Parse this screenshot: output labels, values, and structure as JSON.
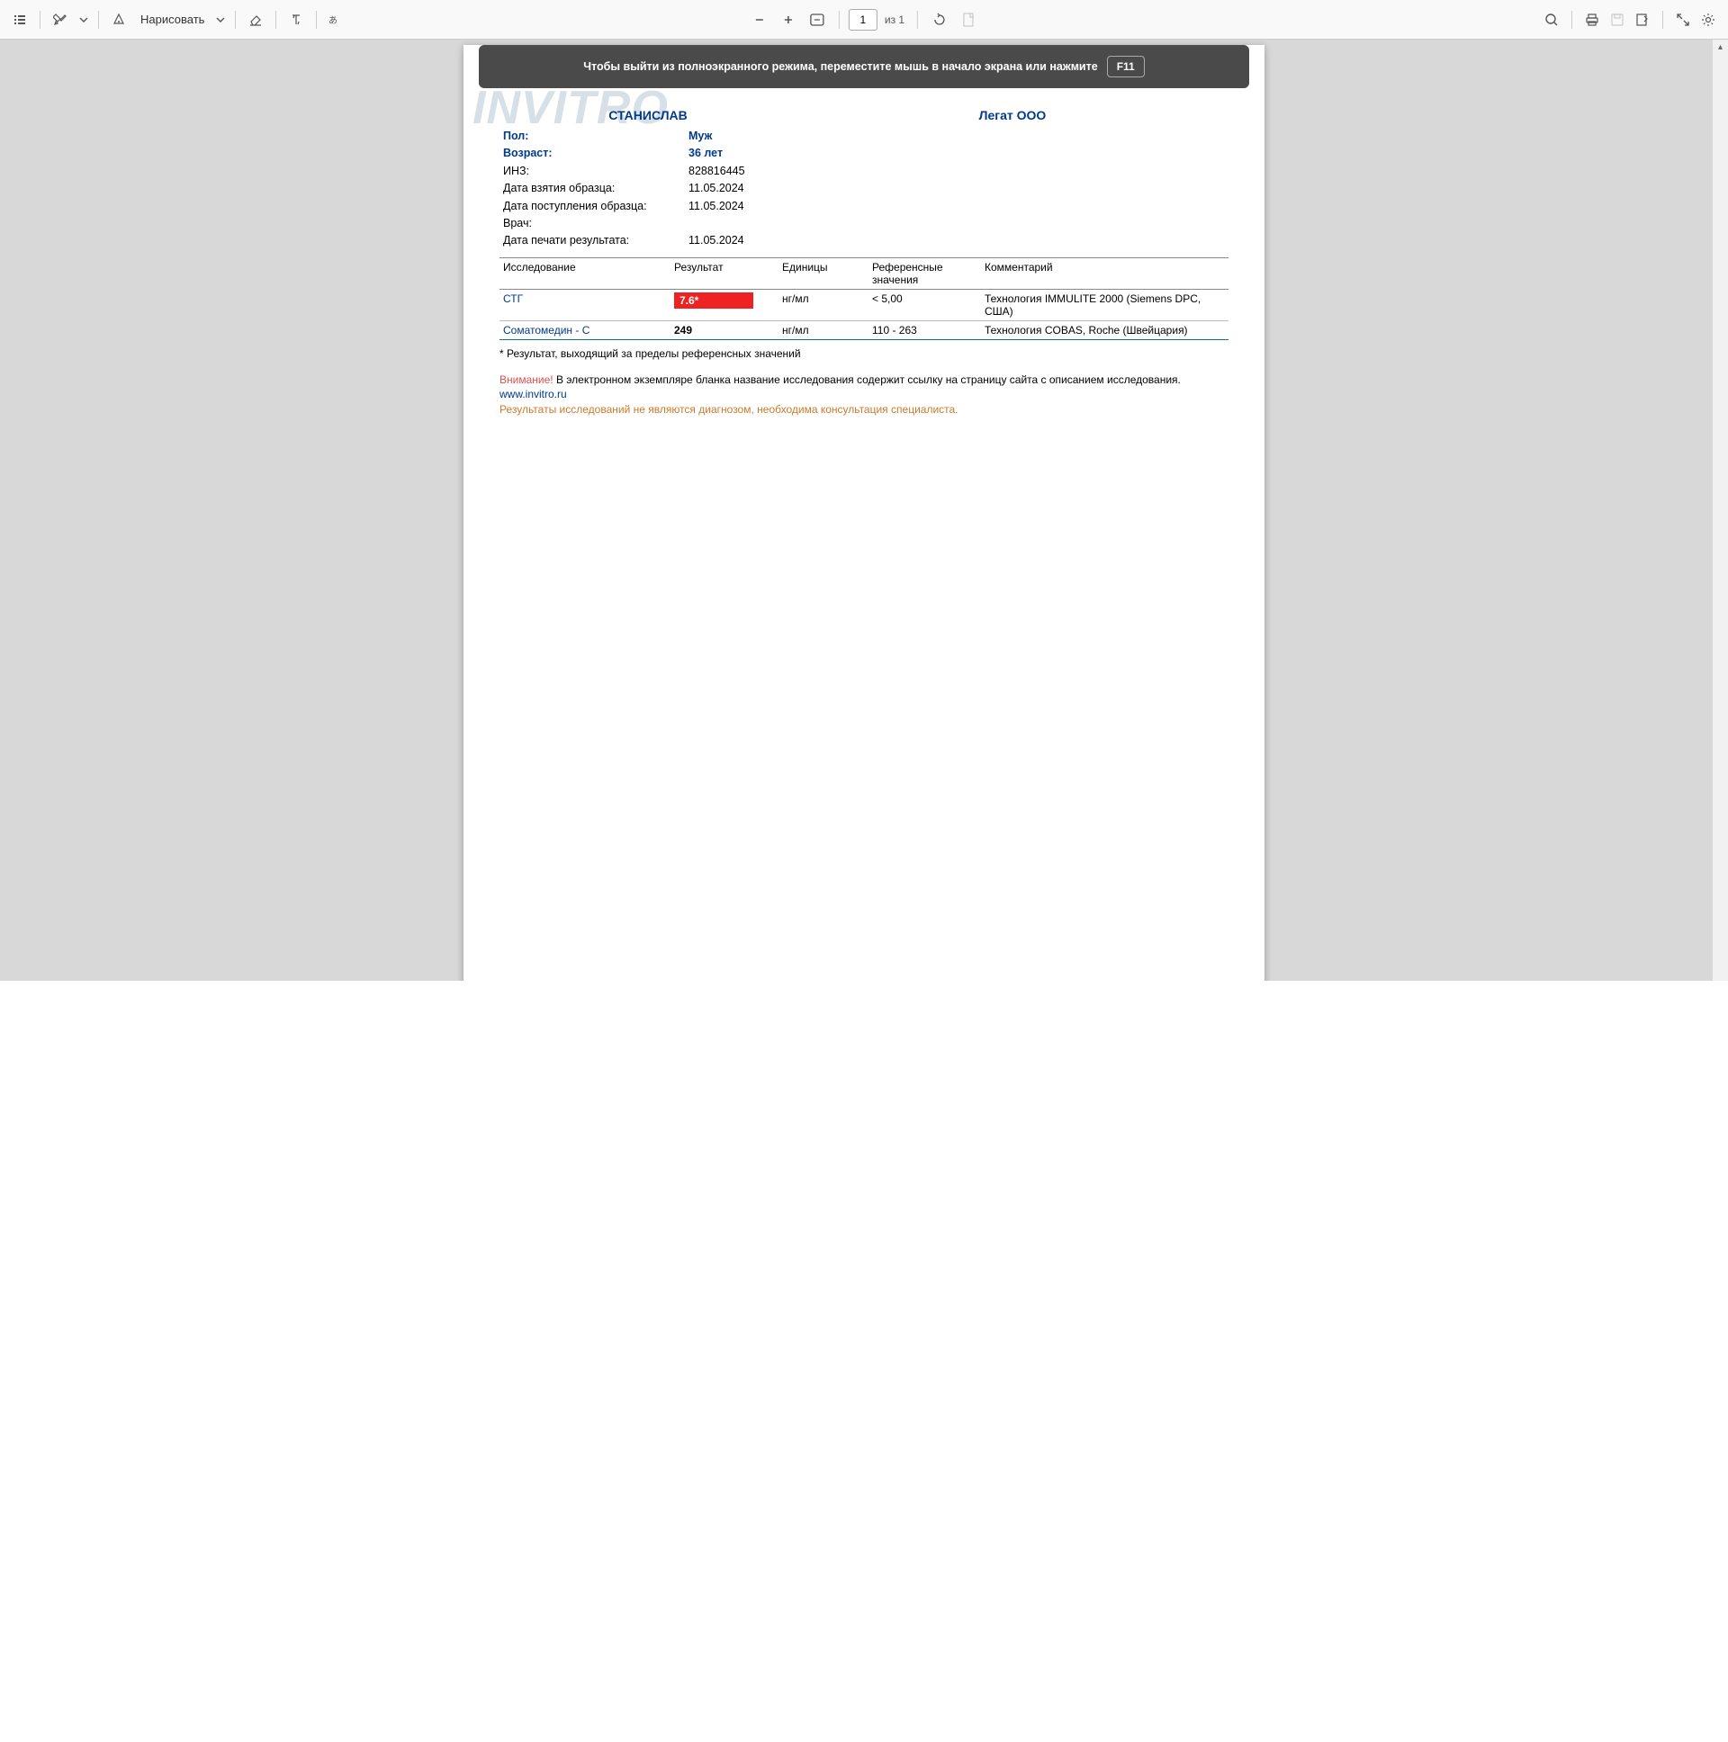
{
  "toolbar": {
    "draw_label": "Нарисовать",
    "page_value": "1",
    "page_of": "из 1"
  },
  "notice": {
    "text": "Чтобы выйти из полноэкранного режима, переместите мышь в начало экрана или нажмите",
    "key": "F11"
  },
  "watermark": "INVITRO",
  "header": {
    "patient": "СТАНИСЛАВ",
    "org": "Легат ООО"
  },
  "info": [
    {
      "label": "Пол:",
      "value": "Муж",
      "bold": true
    },
    {
      "label": "Возраст:",
      "value": "36 лет",
      "bold": true
    },
    {
      "label": "ИНЗ:",
      "value": "828816445"
    },
    {
      "label": "Дата взятия образца:",
      "value": "11.05.2024"
    },
    {
      "label": "Дата поступления образца:",
      "value": "11.05.2024"
    },
    {
      "label": "Врач:",
      "value": ""
    },
    {
      "label": "Дата печати результата:",
      "value": "11.05.2024"
    }
  ],
  "columns": {
    "test": "Исследование",
    "result": "Результат",
    "units": "Единицы",
    "ref": "Референсные значения",
    "comment": "Комментарий"
  },
  "rows": [
    {
      "test": "СТГ",
      "result": "7.6*",
      "abnormal": true,
      "units": "нг/мл",
      "ref": "< 5,00",
      "comment": "Технология IMMULITE 2000 (Siemens DPC, США)"
    },
    {
      "test": "Соматомедин - С",
      "result": "249",
      "abnormal": false,
      "units": "нг/мл",
      "ref": "110 - 263",
      "comment": "Технология COBAS, Roche (Швейцария)"
    }
  ],
  "footnote": "* Результат, выходящий за пределы референсных значений",
  "warning": {
    "word": "Внимание!",
    "text": " В электронном экземпляре бланка название исследования содержит ссылку на страницу сайта с описанием исследования. ",
    "site": "www.invitro.ru",
    "disclaimer": "Результаты исследований не являются диагнозом, необходима консультация специалиста."
  }
}
